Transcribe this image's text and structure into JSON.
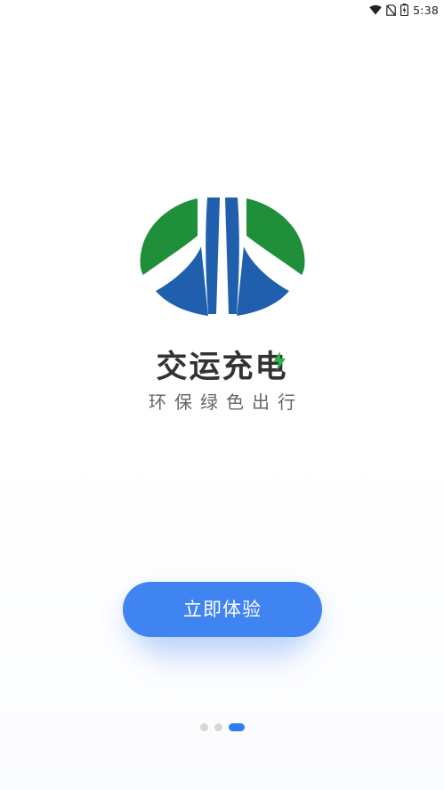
{
  "status_bar": {
    "time": "5:38",
    "icons": [
      "wifi-icon",
      "no-sim-icon",
      "battery-charging-icon"
    ]
  },
  "brand": {
    "name": "交运充电",
    "slogan": "环保绿色出行",
    "colors": {
      "green": "#1f8f3a",
      "blue": "#1f5fae",
      "bolt_green": "#2bb24c"
    }
  },
  "cta": {
    "label": "立即体验",
    "color": "#3f84f0"
  },
  "pager": {
    "total": 3,
    "active_index": 2,
    "active_color": "#2f7df0",
    "inactive_color": "#d6d6d6"
  }
}
